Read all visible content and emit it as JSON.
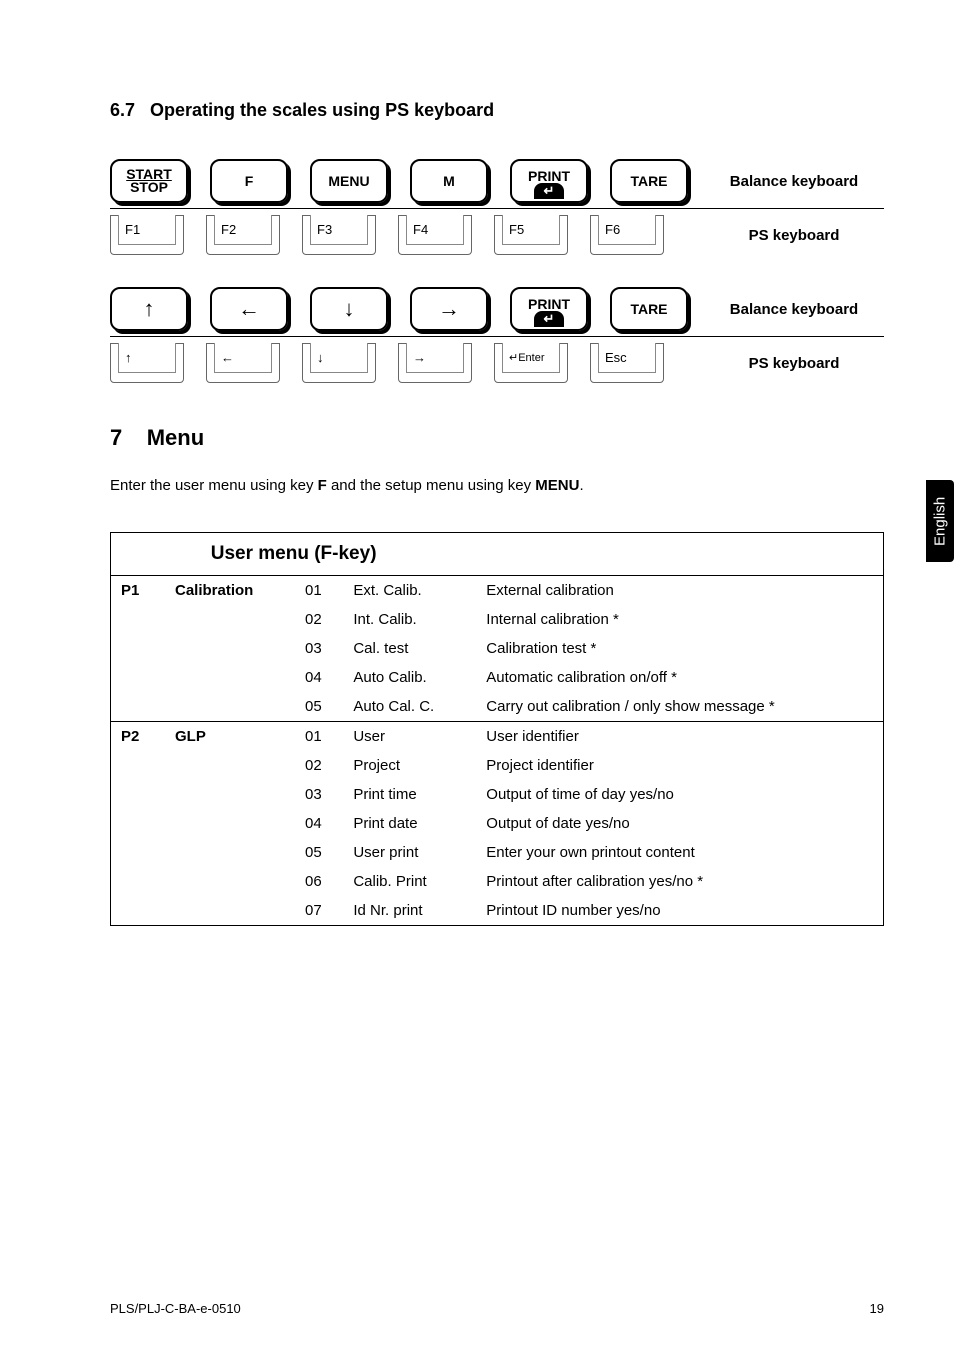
{
  "section_6_7": {
    "number": "6.7",
    "title": "Operating the scales using PS keyboard"
  },
  "kb_map": {
    "row1_balance": [
      "START/STOP",
      "F",
      "MENU",
      "M",
      "PRINT",
      "TARE"
    ],
    "row1_ps": [
      "F1",
      "F2",
      "F3",
      "F4",
      "F5",
      "F6"
    ],
    "row2_balance": [
      "↑",
      "←",
      "↓",
      "→",
      "PRINT",
      "TARE"
    ],
    "row2_ps": [
      "↑",
      "←",
      "↓",
      "→",
      "↵Enter",
      "Esc"
    ],
    "label_balance": "Balance keyboard",
    "label_ps": "PS keyboard"
  },
  "section_7": {
    "number": "7",
    "title": "Menu",
    "intro_pre": "Enter the user menu using key ",
    "intro_f": "F",
    "intro_mid": " and the setup menu using key ",
    "intro_menu": "MENU",
    "intro_post": "."
  },
  "menu_table": {
    "title": "User menu (F-key)",
    "p1": {
      "code": "P1",
      "name": "Calibration",
      "rows": [
        [
          "01",
          "Ext. Calib.",
          "External calibration"
        ],
        [
          "02",
          "Int. Calib.",
          "Internal calibration *"
        ],
        [
          "03",
          "Cal. test",
          "Calibration test *"
        ],
        [
          "04",
          "Auto Calib.",
          "Automatic calibration on/off *"
        ],
        [
          "05",
          "Auto Cal. C.",
          "Carry out calibration / only show message *"
        ]
      ]
    },
    "p2": {
      "code": "P2",
      "name": "GLP",
      "rows": [
        [
          "01",
          "User",
          "User identifier"
        ],
        [
          "02",
          "Project",
          "Project identifier"
        ],
        [
          "03",
          "Print time",
          "Output of time of day yes/no"
        ],
        [
          "04",
          "Print date",
          "Output of date yes/no"
        ],
        [
          "05",
          "User print",
          "Enter your own printout content"
        ],
        [
          "06",
          "Calib. Print",
          "Printout after calibration yes/no *"
        ],
        [
          "07",
          "Id Nr. print",
          "Printout ID number yes/no"
        ]
      ]
    }
  },
  "side_tab": "English",
  "footer": {
    "left": "PLS/PLJ-C-BA-e-0510",
    "right": "19"
  }
}
